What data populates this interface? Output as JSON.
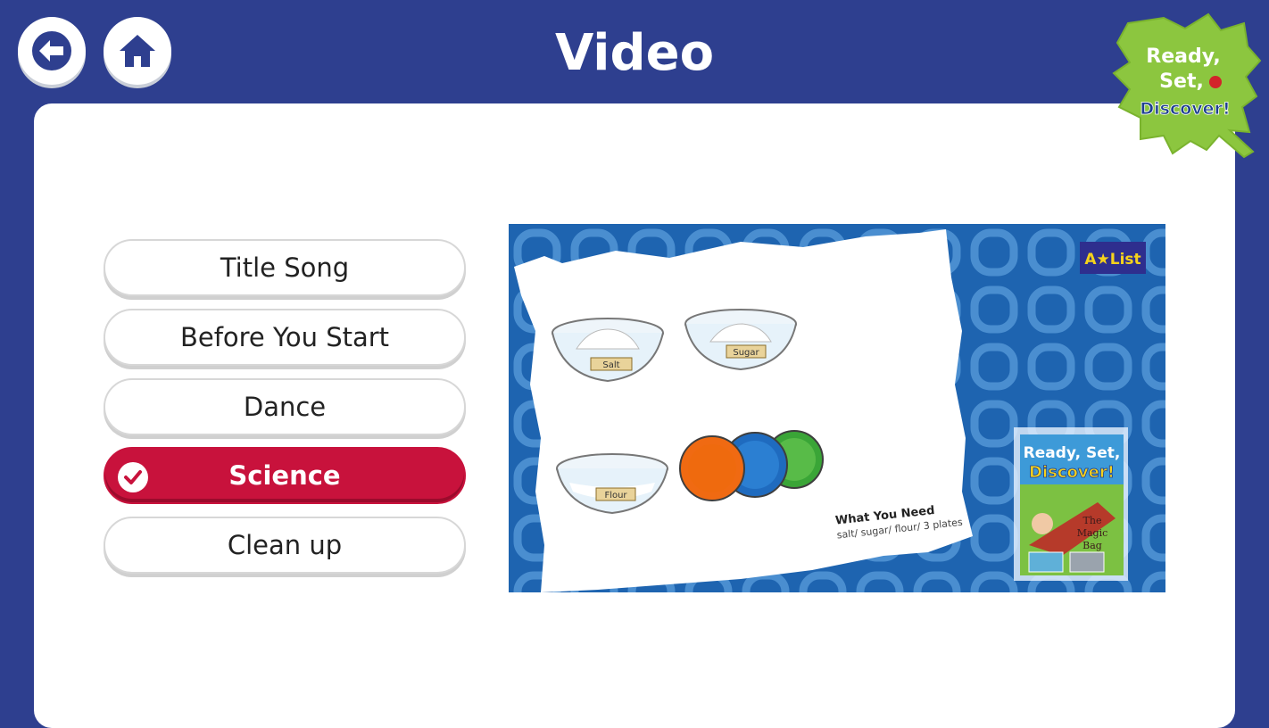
{
  "header": {
    "title": "Video"
  },
  "logo": {
    "line1": "Ready,",
    "line2": "Set,",
    "line3": "Discover!"
  },
  "menu": {
    "items": [
      {
        "label": "Title Song"
      },
      {
        "label": "Before You Start"
      },
      {
        "label": "Dance"
      },
      {
        "label": "Science",
        "selected": true
      },
      {
        "label": "Clean up"
      }
    ]
  },
  "video": {
    "badge": "A★List",
    "bowls": [
      "Salt",
      "Sugar",
      "Flour"
    ],
    "caption_title": "What You Need",
    "caption_items": "salt/ sugar/ flour/ 3 plates",
    "book": {
      "title1": "Ready, Set,",
      "title2": "Discover!",
      "subtitle1": "The",
      "subtitle2": "Magic",
      "subtitle3": "Bag"
    }
  },
  "colors": {
    "background": "#2e3f8f",
    "accent": "#c8123c",
    "video_blue": "#1e64b0",
    "logo_green": "#8cc63f"
  },
  "icons": {
    "back": "back-arrow-icon",
    "home": "home-icon",
    "check": "check-circle-icon"
  }
}
